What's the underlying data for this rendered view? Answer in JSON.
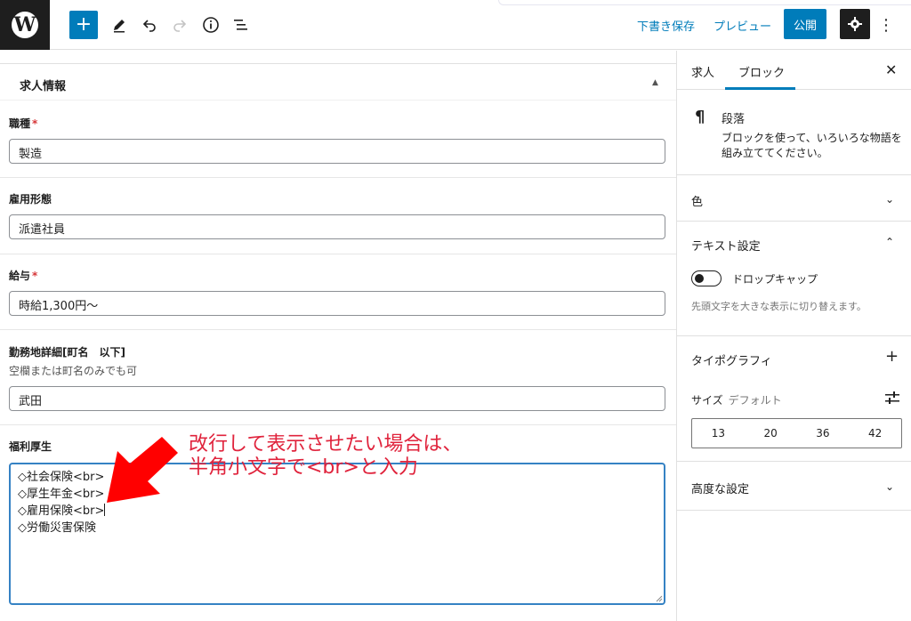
{
  "toolbar": {
    "logo": "W",
    "icons": [
      "plus-icon",
      "pencil-icon",
      "undo-icon",
      "redo-icon",
      "info-icon",
      "list-view-icon"
    ],
    "save_draft": "下書き保存",
    "preview": "プレビュー",
    "publish": "公開",
    "accent_color": "#007cba"
  },
  "panel": {
    "title": "求人情報"
  },
  "fields": [
    {
      "label": "職種",
      "required": "*",
      "value": "製造"
    },
    {
      "label": "雇用形態",
      "value": "派遣社員"
    },
    {
      "label": "給与",
      "required": "*",
      "value": "時給1,300円〜"
    },
    {
      "label": "勤務地詳細[町名　以下]",
      "description": "空欄または町名のみでも可",
      "value": "武田"
    },
    {
      "label": "福利厚生",
      "lines": [
        "◇社会保険<br>",
        "◇厚生年金<br>",
        "◇雇用保険<br>",
        "◇労働災害保険"
      ]
    }
  ],
  "annotation": {
    "line1": "改行して表示させたい場合は、",
    "line2": "半角小文字で<br>と入力",
    "color": "#e0233c"
  },
  "sidebar": {
    "tabs": [
      "求人",
      "ブロック"
    ],
    "active_tab": "ブロック",
    "block": {
      "name": "段落",
      "description": "ブロックを使って、いろいろな物語を組み立ててください。"
    },
    "color_section": "色",
    "text_settings": "テキスト設定",
    "drop_cap_label": "ドロップキャップ",
    "drop_cap_help": "先頭文字を大きな表示に切り替えます。",
    "typography": "タイポグラフィ",
    "size_label": "サイズ",
    "size_value": "デフォルト",
    "sizes": [
      "13",
      "20",
      "36",
      "42"
    ],
    "advanced": "高度な設定"
  }
}
